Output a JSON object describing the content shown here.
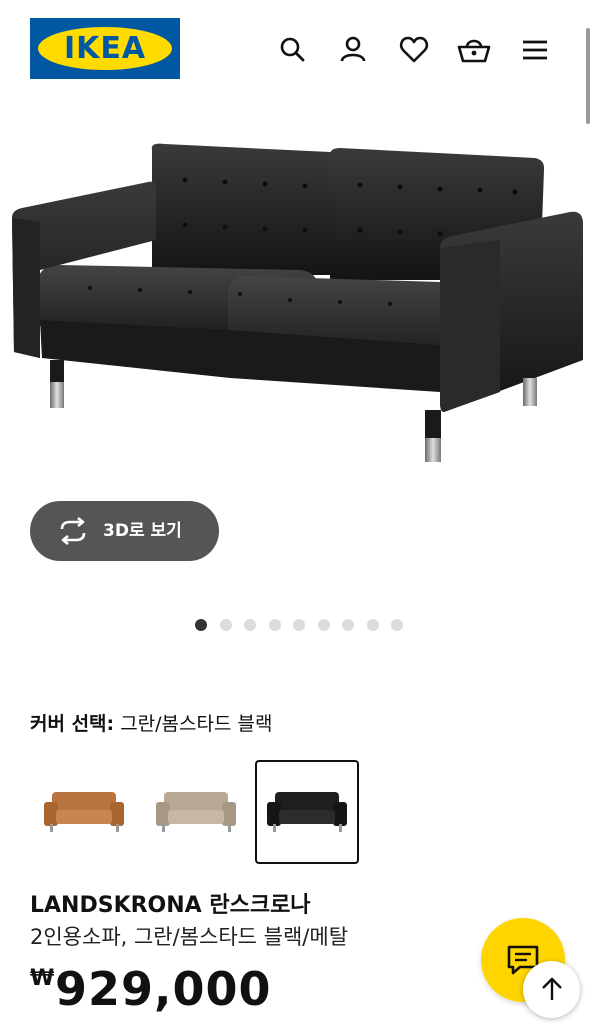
{
  "header": {
    "logo_text": "IKEA",
    "icons": [
      "search-icon",
      "account-icon",
      "heart-icon",
      "basket-icon",
      "menu-icon"
    ]
  },
  "gallery": {
    "view_3d_label": "3D로 보기",
    "slide_count": 9,
    "active_slide": 1
  },
  "cover": {
    "label": "커버 선택:",
    "selected_value": "그란/봄스타드 블랙",
    "swatches": [
      {
        "color": "#b9743f",
        "selected": false
      },
      {
        "color": "#b8a995",
        "selected": false
      },
      {
        "color": "#1f1f1f",
        "selected": true
      }
    ]
  },
  "product": {
    "name": "LANDSKRONA 란스크로나",
    "description": "2인용소파, 그란/봄스타드 블랙/메탈",
    "currency": "₩",
    "price": "929,000"
  },
  "colors": {
    "brand_blue": "#0058a3",
    "brand_yellow": "#ffdb00",
    "chat_yellow": "#ffd500"
  }
}
